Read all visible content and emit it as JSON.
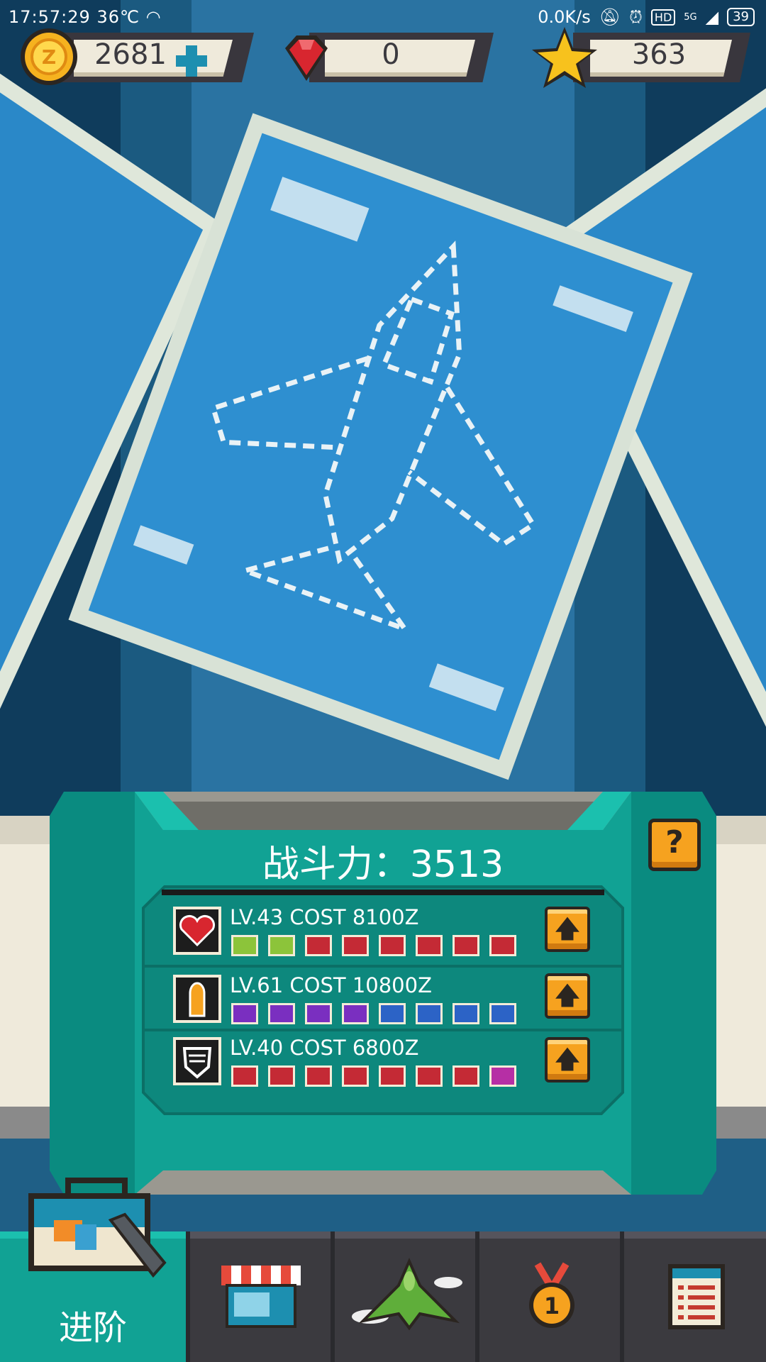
{
  "status_bar": {
    "time": "17:57:29",
    "temperature": "36℃",
    "net_speed": "0.0K/s",
    "hd": "HD",
    "signal": "5G",
    "battery": "39"
  },
  "currency": {
    "coins": "2681",
    "gems": "0",
    "stars": "363"
  },
  "panel": {
    "power_label": "战斗力：3513",
    "rows": [
      {
        "icon": "heart-icon",
        "text": "LV.43 COST 8100Z",
        "squares": [
          "#8cc43a",
          "#8cc43a",
          "#c42a35",
          "#c42a35",
          "#c42a35",
          "#c42a35",
          "#c42a35",
          "#c42a35"
        ]
      },
      {
        "icon": "bullet-icon",
        "text": "LV.61 COST 10800Z",
        "squares": [
          "#7a2fc0",
          "#7a2fc0",
          "#7a2fc0",
          "#7a2fc0",
          "#2c63c6",
          "#2c63c6",
          "#2c63c6",
          "#2c63c6"
        ]
      },
      {
        "icon": "shield-icon",
        "text": "LV.40 COST 6800Z",
        "squares": [
          "#c42a35",
          "#c42a35",
          "#c42a35",
          "#c42a35",
          "#c42a35",
          "#c42a35",
          "#c42a35",
          "#b62fa5"
        ]
      }
    ]
  },
  "nav": {
    "active_label": "进阶",
    "tabs": [
      "upgrade",
      "shop",
      "plane",
      "medal",
      "tasks"
    ]
  },
  "colors": {
    "teal": "#11a294",
    "dark": "#3b3a3f",
    "orange": "#f6a21f",
    "blueprint": "#2e8fd0"
  }
}
